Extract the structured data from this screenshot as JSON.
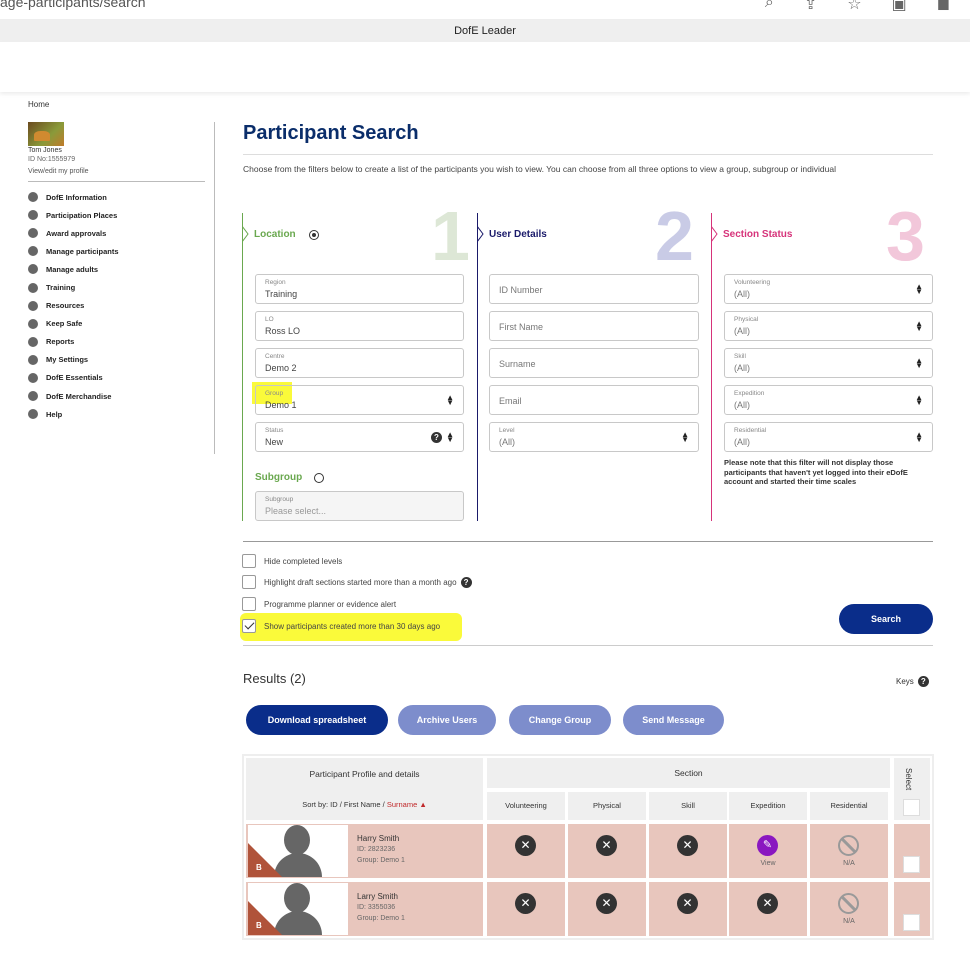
{
  "browser": {
    "url": "age-participants/search",
    "window_title": "DofE Leader"
  },
  "sidebar": {
    "home": "Home",
    "user_name": "Tom Jones",
    "user_id": "ID No:1555979",
    "profile_link": "View/edit my profile",
    "items": [
      {
        "label": "DofE Information",
        "icon": "info-icon"
      },
      {
        "label": "Participation Places",
        "icon": "person-icon"
      },
      {
        "label": "Award approvals",
        "icon": "award-icon"
      },
      {
        "label": "Manage participants",
        "icon": "people-icon"
      },
      {
        "label": "Manage adults",
        "icon": "adults-icon"
      },
      {
        "label": "Training",
        "icon": "training-icon"
      },
      {
        "label": "Resources",
        "icon": "resources-icon"
      },
      {
        "label": "Keep Safe",
        "icon": "lock-icon"
      },
      {
        "label": "Reports",
        "icon": "reports-icon"
      },
      {
        "label": "My Settings",
        "icon": "gear-icon"
      },
      {
        "label": "DofE Essentials",
        "icon": "essentials-icon"
      },
      {
        "label": "DofE Merchandise",
        "icon": "merchandise-icon"
      },
      {
        "label": "Help",
        "icon": "help-icon"
      }
    ]
  },
  "main": {
    "title": "Participant Search",
    "intro": "Choose from the filters below to create a list of the participants you wish to view. You can choose from all three options to view a group, subgroup or individual"
  },
  "location": {
    "title": "Location",
    "number": "1",
    "region_label": "Region",
    "region_value": "Training",
    "lo_label": "LO",
    "lo_value": "Ross LO",
    "centre_label": "Centre",
    "centre_value": "Demo 2",
    "group_label": "Group",
    "group_value": "Demo 1",
    "status_label": "Status",
    "status_value": "New",
    "subgroup_title": "Subgroup",
    "subgroup_label": "Subgroup",
    "subgroup_placeholder": "Please select..."
  },
  "user_details": {
    "title": "User Details",
    "number": "2",
    "id_placeholder": "ID Number",
    "first_name_placeholder": "First Name",
    "surname_placeholder": "Surname",
    "email_placeholder": "Email",
    "level_label": "Level",
    "level_value": "(All)"
  },
  "section_status": {
    "title": "Section Status",
    "number": "3",
    "filters": [
      {
        "label": "Volunteering",
        "value": "(All)"
      },
      {
        "label": "Physical",
        "value": "(All)"
      },
      {
        "label": "Skill",
        "value": "(All)"
      },
      {
        "label": "Expedition",
        "value": "(All)"
      },
      {
        "label": "Residential",
        "value": "(All)"
      }
    ],
    "note": "Please note that this filter will not display those participants that haven't yet logged into their eDofE account and started their time scales"
  },
  "options": {
    "hide_completed": "Hide completed levels",
    "highlight_draft": "Highlight draft sections started more than a month ago",
    "planner_alert": "Programme planner or evidence alert",
    "show_old": "Show participants created more than 30 days ago",
    "search": "Search"
  },
  "results": {
    "title": "Results (2)",
    "keys": "Keys",
    "download": "Download spreadsheet",
    "archive": "Archive Users",
    "change_group": "Change Group",
    "send_message": "Send Message",
    "col_profile": "Participant Profile and details",
    "sort_by": "Sort by:",
    "sort_id": "ID",
    "sort_first": "First Name",
    "sort_surname": "Surname",
    "col_section": "Section",
    "col_select": "Select",
    "sections": [
      "Volunteering",
      "Physical",
      "Skill",
      "Expedition",
      "Residential"
    ],
    "rows": [
      {
        "name": "Harry Smith",
        "id": "ID: 2823236",
        "group": "Group: Demo 1",
        "level": "B",
        "expedition": "View",
        "residential": "N/A"
      },
      {
        "name": "Larry Smith",
        "id": "ID: 3355036",
        "group": "Group: Demo 1",
        "level": "B",
        "residential": "N/A"
      }
    ]
  },
  "colors": {
    "navy": "#0a2d6a",
    "location_green": "#6aa84f",
    "user_navy": "#1a1a6a",
    "section_pink": "#d6337a",
    "button_blue": "#0a2d8a",
    "button_muted": "#7d8dcc",
    "row_bg": "#e8c6bd",
    "highlight": "#fafa3a",
    "expedition_purple": "#8a17c0"
  }
}
